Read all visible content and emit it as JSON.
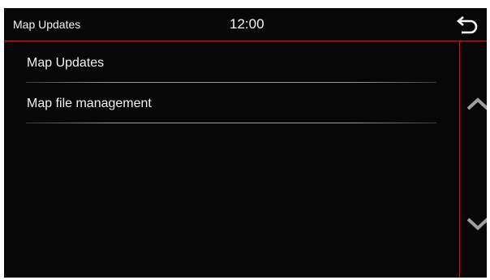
{
  "header": {
    "title": "Map Updates",
    "clock": "12:00",
    "back_icon": "back-arrow-icon"
  },
  "menu": {
    "items": [
      {
        "label": "Map Updates"
      },
      {
        "label": "Map file management"
      }
    ]
  },
  "scroll": {
    "up_icon": "chevron-up-icon",
    "down_icon": "chevron-down-icon"
  },
  "colors": {
    "background": "#070707",
    "accent": "#b0222c",
    "text": "#f2f2f2",
    "arrows": "#a0a0a0"
  }
}
